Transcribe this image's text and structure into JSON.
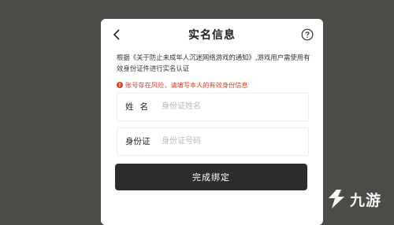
{
  "dialog": {
    "title": "实名信息",
    "back_icon": "chevron-left-icon",
    "help_icon": "question-circle-icon",
    "notice": "根据《关于防止未成年人沉迷网络游戏的通知》,游戏用户需使用有效身份证件进行实名认证",
    "warning_icon": "exclamation-circle-icon",
    "warning": "账号存在风险，请填写本人的有效身份信息",
    "name_field": {
      "label": "姓名",
      "placeholder": "身份证姓名",
      "value": ""
    },
    "id_field": {
      "label": "身份证",
      "placeholder": "身份证号码",
      "value": ""
    },
    "submit_label": "完成绑定"
  },
  "watermark": {
    "text": "九游",
    "icon": "jiuyou-logo"
  },
  "colors": {
    "backdrop": "#4b4b48",
    "dialog": "#ffffff",
    "warning": "#d9402a",
    "button": "#2d2d2c"
  }
}
